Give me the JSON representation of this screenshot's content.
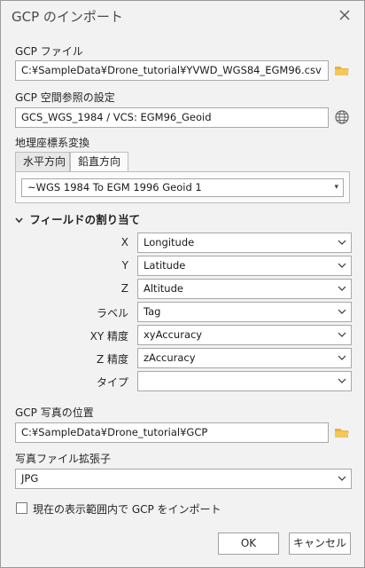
{
  "window": {
    "title": "GCP のインポート"
  },
  "gcp_file": {
    "label": "GCP ファイル",
    "value": "C:¥SampleData¥Drone_tutorial¥YVWD_WGS84_EGM96.csv"
  },
  "spatial_ref": {
    "label": "GCP 空間参照の設定",
    "value": "GCS_WGS_1984 / VCS: EGM96_Geoid"
  },
  "transform": {
    "label": "地理座標系変換",
    "tabs": [
      "水平方向",
      "鉛直方向"
    ],
    "active_tab": "鉛直方向",
    "value": "~WGS 1984 To EGM 1996 Geoid 1"
  },
  "field_mapping": {
    "heading": "フィールドの割り当て",
    "rows": [
      {
        "label": "X",
        "value": "Longitude"
      },
      {
        "label": "Y",
        "value": "Latitude"
      },
      {
        "label": "Z",
        "value": "Altitude"
      },
      {
        "label": "ラベル",
        "value": "Tag"
      },
      {
        "label": "XY 精度",
        "value": "xyAccuracy"
      },
      {
        "label": "Z 精度",
        "value": "zAccuracy"
      },
      {
        "label": "タイプ",
        "value": ""
      }
    ]
  },
  "photo_location": {
    "label": "GCP 写真の位置",
    "value": "C:¥SampleData¥Drone_tutorial¥GCP"
  },
  "photo_ext": {
    "label": "写真ファイル拡張子",
    "value": "JPG"
  },
  "extent_option": {
    "label": "現在の表示範囲内で GCP をインポート",
    "checked": false
  },
  "buttons": {
    "ok": "OK",
    "cancel": "キャンセル"
  },
  "colors": {
    "folder": "#e8b23a",
    "accent": "#1f6fb5"
  },
  "icons": {
    "close": "close-icon",
    "folder": "folder-icon",
    "globe": "globe-icon",
    "chevron": "chevron-down-icon"
  }
}
